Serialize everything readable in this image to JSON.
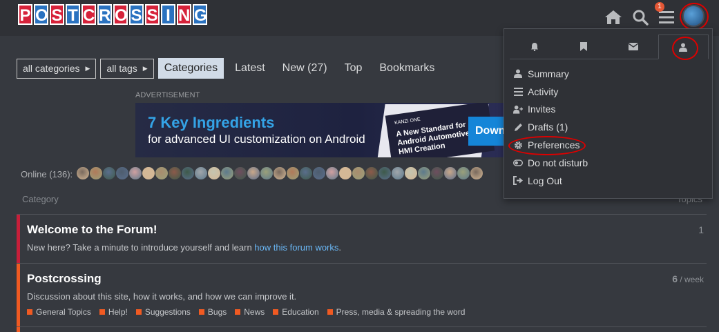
{
  "header": {
    "logo_letters": [
      "P",
      "O",
      "S",
      "T",
      "C",
      "R",
      "O",
      "S",
      "S",
      "I",
      "N",
      "G"
    ],
    "notification_count": "1",
    "icons": [
      "home-icon",
      "search-icon",
      "hamburger-menu-icon",
      "user-avatar"
    ]
  },
  "nav": {
    "all_categories": "all categories",
    "all_tags": "all tags",
    "links": [
      {
        "label": "Categories",
        "active": true
      },
      {
        "label": "Latest",
        "active": false
      },
      {
        "label": "New (27)",
        "active": false
      },
      {
        "label": "Top",
        "active": false
      },
      {
        "label": "Bookmarks",
        "active": false
      }
    ]
  },
  "ad": {
    "label": "ADVERTISEMENT",
    "headline": "7 Key Ingredients",
    "subline": "for advanced UI customization on Android",
    "card_brand": "KANZI ONE",
    "card_text": "A New Standard for Android Automotive HMI Creation",
    "button": "Down"
  },
  "online": {
    "label": "Online (136):"
  },
  "table": {
    "category_header": "Category",
    "topics_header": "Topics"
  },
  "categories": [
    {
      "title": "Welcome to the Forum!",
      "desc_prefix": "New here? Take a minute to introduce yourself and learn ",
      "desc_link": "how this forum works",
      "desc_suffix": ".",
      "count": "1",
      "count_unit": "",
      "color": "#c71f3a"
    },
    {
      "title": "Postcrossing",
      "desc": "Discussion about this site, how it works, and how we can improve it.",
      "count": "6",
      "count_unit": " / week",
      "color": "#f05a22",
      "subcategories": [
        "General Topics",
        "Help!",
        "Suggestions",
        "Bugs",
        "News",
        "Education",
        "Press, media & spreading the word"
      ]
    }
  ],
  "user_menu": {
    "tabs": [
      "bell-icon",
      "bookmark-icon",
      "envelope-icon",
      "user-icon"
    ],
    "items": [
      {
        "label": "Summary",
        "icon": "user-icon"
      },
      {
        "label": "Activity",
        "icon": "list-icon"
      },
      {
        "label": "Invites",
        "icon": "user-plus-icon"
      },
      {
        "label": "Drafts (1)",
        "icon": "pencil-icon"
      },
      {
        "label": "Preferences",
        "icon": "gear-icon"
      },
      {
        "label": "Do not disturb",
        "icon": "toggle-icon"
      },
      {
        "label": "Log Out",
        "icon": "sign-out-icon"
      }
    ]
  },
  "colors": {
    "background": "#36393f",
    "header": "#2f3136",
    "accent_link": "#6ab7f5",
    "badge": "#e45735",
    "annotation": "#dd0000"
  }
}
